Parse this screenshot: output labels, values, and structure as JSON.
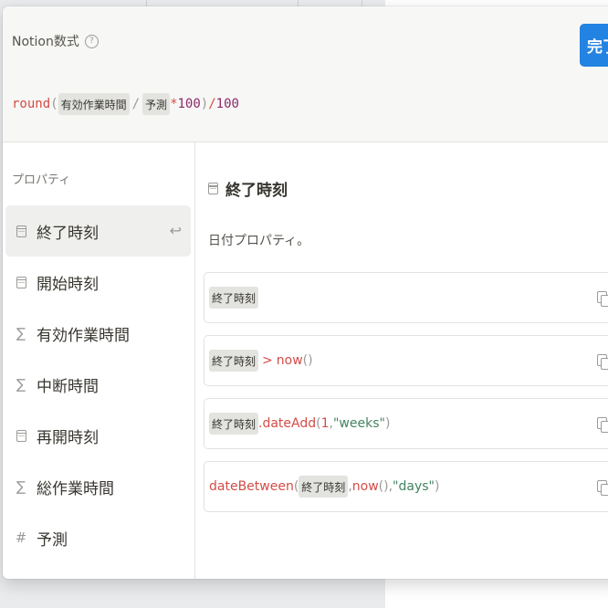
{
  "editor": {
    "title": "Notion数式",
    "help_icon": "?",
    "done_label": "完了",
    "formula": {
      "fn": "round",
      "open": "(",
      "token1": "有効作業時間",
      "op_divide": "/",
      "token2": "予測",
      "op_multiply": "*",
      "num1": "100",
      "close": ")",
      "op_divide2": "/",
      "num2": "100"
    }
  },
  "sidebar": {
    "heading": "プロパティ",
    "items": [
      {
        "label": "終了時刻",
        "icon": "calendar-icon"
      },
      {
        "label": "開始時刻",
        "icon": "calendar-icon"
      },
      {
        "label": "有効作業時間",
        "icon": "sigma-icon"
      },
      {
        "label": "中断時間",
        "icon": "sigma-icon"
      },
      {
        "label": "再開時刻",
        "icon": "calendar-icon"
      },
      {
        "label": "総作業時間",
        "icon": "sigma-icon"
      },
      {
        "label": "予測",
        "icon": "hash-icon"
      }
    ],
    "glyphs": {
      "sigma": "∑",
      "hash": "#",
      "return": "↩"
    }
  },
  "detail": {
    "title": "終了時刻",
    "description": "日付プロパティ。",
    "examples": {
      "ex1": {
        "token": "終了時刻"
      },
      "ex2": {
        "token": "終了時刻",
        "op": ">",
        "fn": "now",
        "args": "()"
      },
      "ex3": {
        "token": "終了時刻",
        "method": ".dateAdd",
        "open": "(",
        "num": "1",
        "comma": ", ",
        "str": "\"weeks\"",
        "close": ")"
      },
      "ex4": {
        "fn": "dateBetween",
        "open": "(",
        "token": "終了時刻",
        "comma1": ", ",
        "fn2": "now",
        "args": "()",
        "comma2": ", ",
        "str": "\"days\"",
        "close": ")"
      }
    }
  },
  "colors": {
    "accent": "#2383e2",
    "function": "#d44c47",
    "string": "#448361",
    "token_bg": "#e3e3e0"
  }
}
